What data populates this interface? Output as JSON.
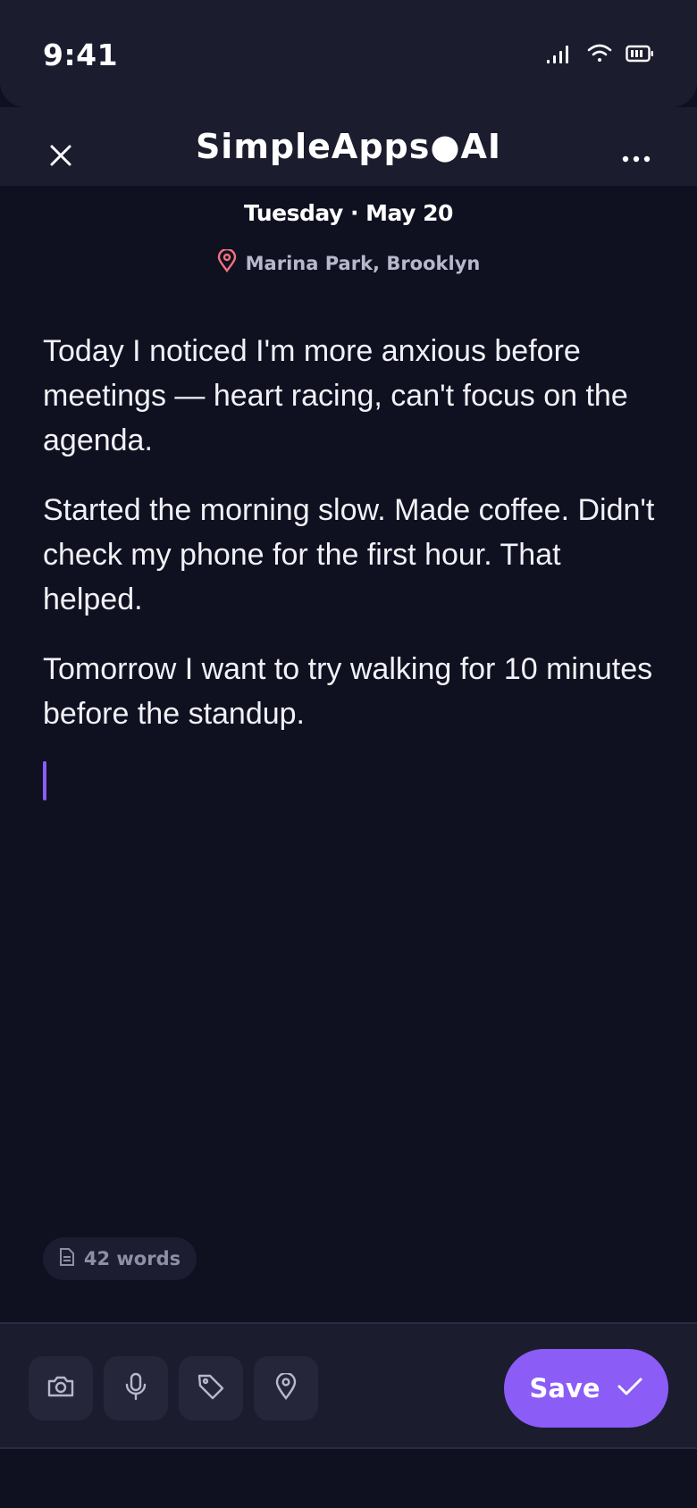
{
  "status_bar": {
    "time": "9:41",
    "icons": [
      "signal-icon",
      "wifi-icon",
      "battery-icon"
    ]
  },
  "header": {
    "title": "SimpleApps●AI",
    "close_icon": "close-icon",
    "more_icon": "more-icon"
  },
  "entry": {
    "date": "Tuesday · May 20",
    "location": "Marina Park, Brooklyn",
    "paragraphs": [
      "Today I noticed I'm more anxious before meetings — heart racing, can't focus on the agenda.",
      "Started the morning slow. Made coffee. Didn't check my phone for the first hour. That helped.",
      "Tomorrow I want to try walking for 10 minutes before the standup."
    ]
  },
  "word_count": "42 words",
  "toolbar": {
    "tools": [
      "camera-icon",
      "microphone-icon",
      "tag-icon",
      "location-pin-icon"
    ],
    "save_label": "Save"
  },
  "colors": {
    "accent": "#8b5cf6",
    "background": "#0f1020",
    "surface": "#1b1c2e",
    "pin": "#f0727e"
  }
}
